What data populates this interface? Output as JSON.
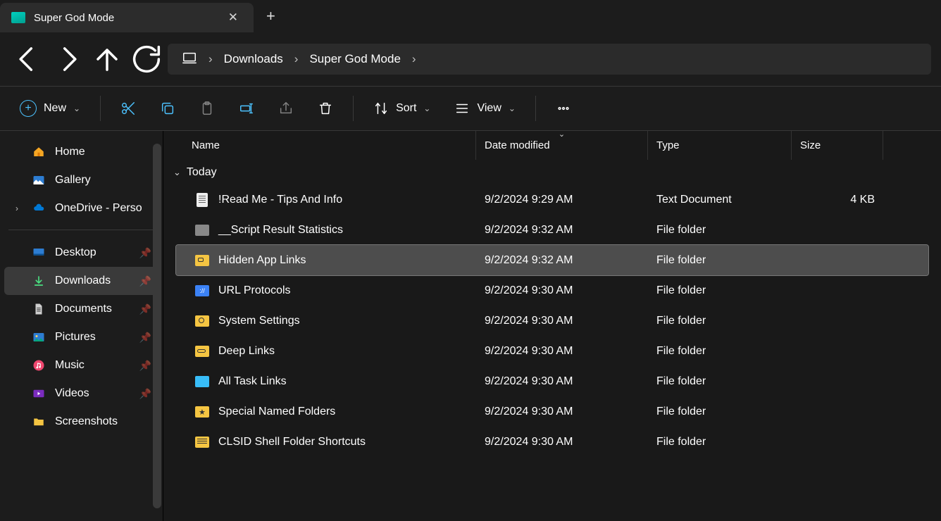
{
  "tab": {
    "title": "Super God Mode"
  },
  "breadcrumb": [
    "Downloads",
    "Super God Mode"
  ],
  "toolbar": {
    "new": "New",
    "sort": "Sort",
    "view": "View"
  },
  "columns": {
    "name": "Name",
    "date": "Date modified",
    "type": "Type",
    "size": "Size"
  },
  "group": "Today",
  "sidebar": {
    "top": [
      {
        "label": "Home",
        "icon": "home"
      },
      {
        "label": "Gallery",
        "icon": "gallery"
      },
      {
        "label": "OneDrive - Perso",
        "icon": "onedrive",
        "expandable": true
      }
    ],
    "quick": [
      {
        "label": "Desktop",
        "icon": "desktop",
        "pinned": true
      },
      {
        "label": "Downloads",
        "icon": "downloads",
        "pinned": true,
        "active": true
      },
      {
        "label": "Documents",
        "icon": "documents",
        "pinned": true
      },
      {
        "label": "Pictures",
        "icon": "pictures",
        "pinned": true
      },
      {
        "label": "Music",
        "icon": "music",
        "pinned": true
      },
      {
        "label": "Videos",
        "icon": "videos",
        "pinned": true
      },
      {
        "label": "Screenshots",
        "icon": "folder"
      }
    ]
  },
  "files": [
    {
      "name": "!Read Me - Tips And Info",
      "date": "9/2/2024 9:29 AM",
      "type": "Text Document",
      "size": "4 KB",
      "icon": "txt"
    },
    {
      "name": "__Script Result Statistics",
      "date": "9/2/2024 9:32 AM",
      "type": "File folder",
      "size": "",
      "icon": "folder-gray"
    },
    {
      "name": "Hidden App Links",
      "date": "9/2/2024 9:32 AM",
      "type": "File folder",
      "size": "",
      "icon": "folder-cam",
      "selected": true
    },
    {
      "name": "URL Protocols",
      "date": "9/2/2024 9:30 AM",
      "type": "File folder",
      "size": "",
      "icon": "folder-url"
    },
    {
      "name": "System Settings",
      "date": "9/2/2024 9:30 AM",
      "type": "File folder",
      "size": "",
      "icon": "folder-gear"
    },
    {
      "name": "Deep Links",
      "date": "9/2/2024 9:30 AM",
      "type": "File folder",
      "size": "",
      "icon": "folder-link"
    },
    {
      "name": "All Task Links",
      "date": "9/2/2024 9:30 AM",
      "type": "File folder",
      "size": "",
      "icon": "folder-task"
    },
    {
      "name": "Special Named Folders",
      "date": "9/2/2024 9:30 AM",
      "type": "File folder",
      "size": "",
      "icon": "folder-star"
    },
    {
      "name": "CLSID Shell Folder Shortcuts",
      "date": "9/2/2024 9:30 AM",
      "type": "File folder",
      "size": "",
      "icon": "folder-clsid"
    }
  ]
}
